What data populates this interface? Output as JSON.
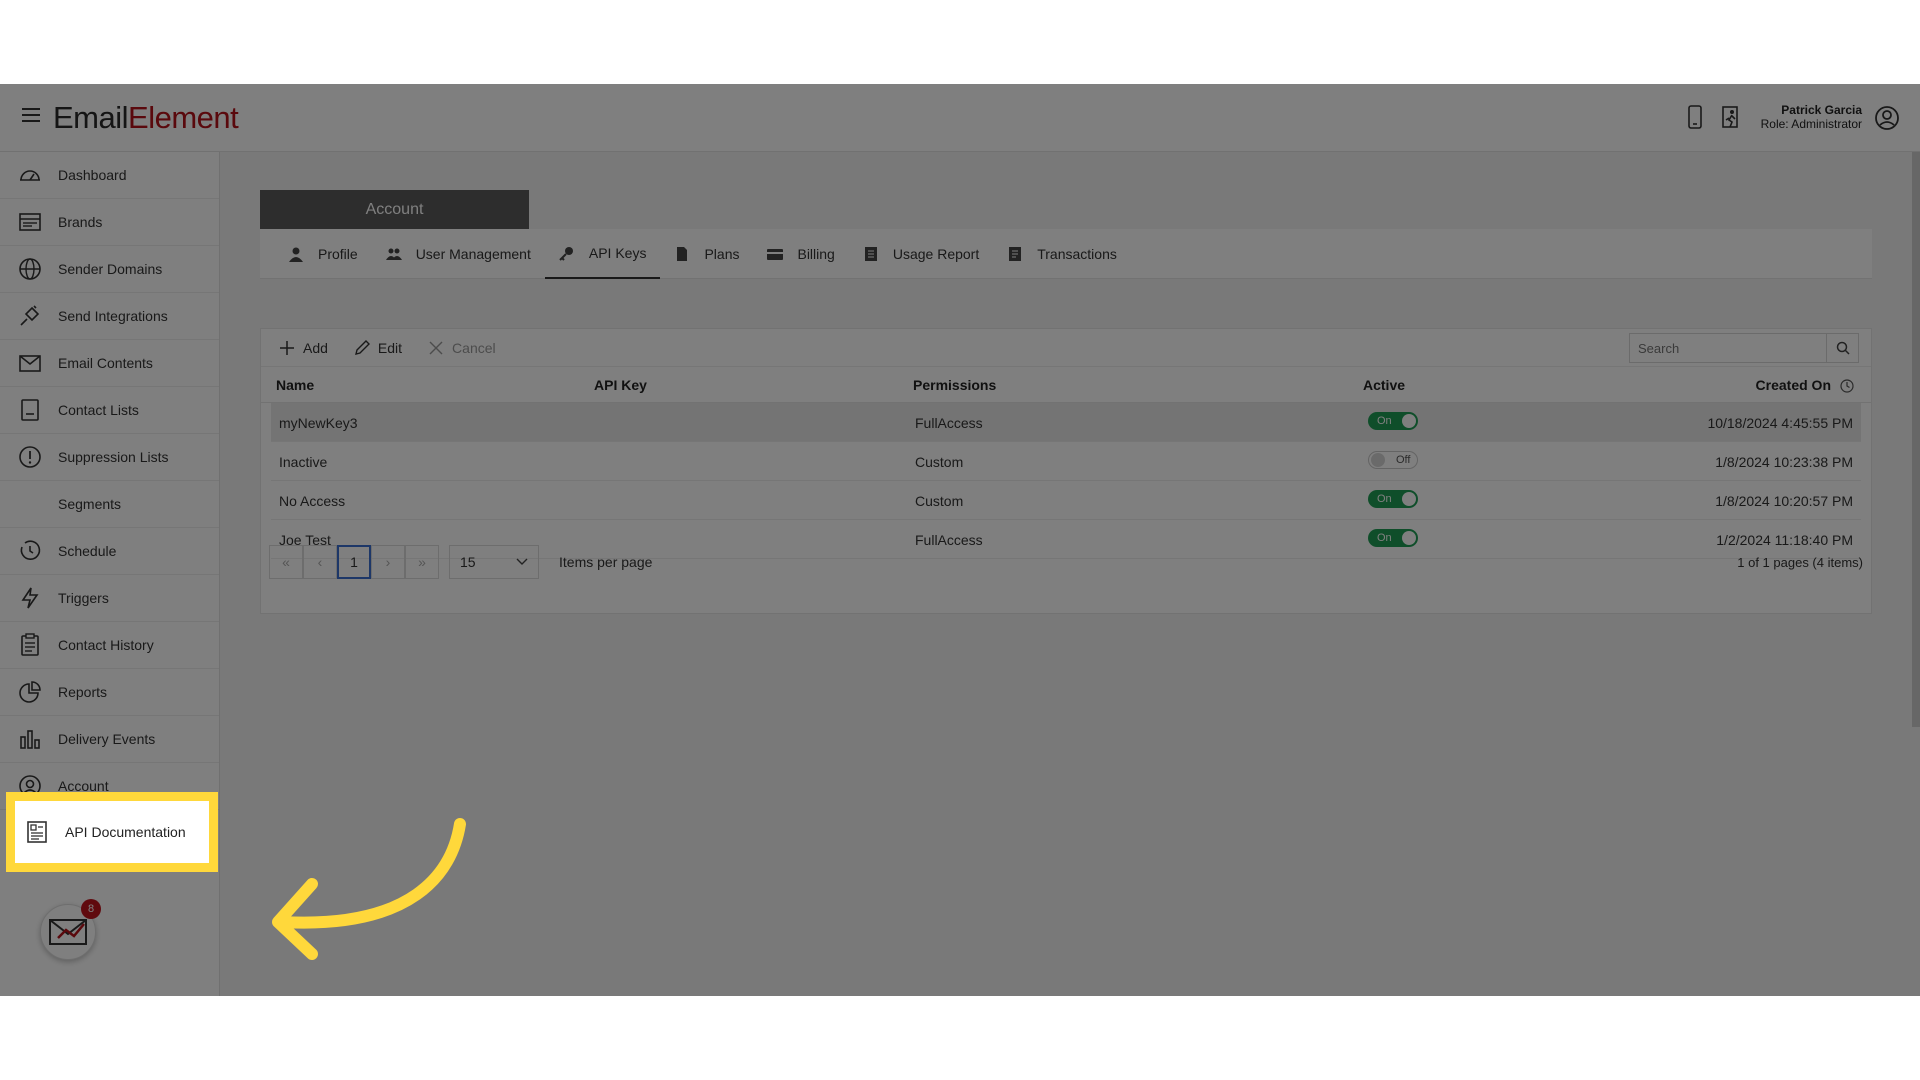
{
  "app": {
    "logo_part1": "Email",
    "logo_part2": "Element"
  },
  "user": {
    "name": "Patrick Garcia",
    "role": "Role: Administrator"
  },
  "sidebar": {
    "items": [
      {
        "label": "Dashboard",
        "icon": "dashboard-icon"
      },
      {
        "label": "Brands",
        "icon": "brands-icon"
      },
      {
        "label": "Sender Domains",
        "icon": "globe-icon"
      },
      {
        "label": "Send Integrations",
        "icon": "plug-icon"
      },
      {
        "label": "Email Contents",
        "icon": "envelope-icon"
      },
      {
        "label": "Contact Lists",
        "icon": "list-icon"
      },
      {
        "label": "Suppression Lists",
        "icon": "alert-icon"
      },
      {
        "label": "Segments",
        "icon": ""
      },
      {
        "label": "Schedule",
        "icon": "clock-icon"
      },
      {
        "label": "Triggers",
        "icon": "bolt-icon"
      },
      {
        "label": "Contact History",
        "icon": "clipboard-icon"
      },
      {
        "label": "Reports",
        "icon": "pie-chart-icon"
      },
      {
        "label": "Delivery Events",
        "icon": "bar-chart-icon"
      },
      {
        "label": "Account",
        "icon": "user-circle-icon"
      }
    ],
    "highlighted": {
      "label": "API Documentation",
      "icon": "document-icon"
    },
    "notifications_count": "8"
  },
  "account": {
    "header": "Account",
    "tabs": [
      {
        "label": "Profile",
        "icon": "person-icon"
      },
      {
        "label": "User Management",
        "icon": "users-icon"
      },
      {
        "label": "API Keys",
        "icon": "key-icon",
        "active": true
      },
      {
        "label": "Plans",
        "icon": "file-icon"
      },
      {
        "label": "Billing",
        "icon": "credit-card-icon"
      },
      {
        "label": "Usage Report",
        "icon": "report-icon"
      },
      {
        "label": "Transactions",
        "icon": "receipt-icon"
      }
    ]
  },
  "toolbar": {
    "add": "Add",
    "edit": "Edit",
    "cancel": "Cancel",
    "search_placeholder": "Search"
  },
  "table": {
    "columns": [
      "Name",
      "API Key",
      "Permissions",
      "Active",
      "Created On"
    ],
    "rows": [
      {
        "name": "myNewKey3",
        "api_key": "",
        "permissions": "FullAccess",
        "active": "On",
        "created": "10/18/2024 4:45:55 PM"
      },
      {
        "name": "Inactive",
        "api_key": "",
        "permissions": "Custom",
        "active": "Off",
        "created": "1/8/2024 10:23:38 PM"
      },
      {
        "name": "No Access",
        "api_key": "",
        "permissions": "Custom",
        "active": "On",
        "created": "1/8/2024 10:20:57 PM"
      },
      {
        "name": "Joe Test",
        "api_key": "",
        "permissions": "FullAccess",
        "active": "On",
        "created": "1/2/2024 11:18:40 PM"
      }
    ]
  },
  "pager": {
    "current_page": "1",
    "page_size": "15",
    "items_per_page_label": "Items per page",
    "info": "1 of 1 pages (4 items)"
  },
  "colors": {
    "brand_red": "#b5121b",
    "highlight_yellow": "#ffd83b",
    "toggle_on": "#1f9d55"
  }
}
